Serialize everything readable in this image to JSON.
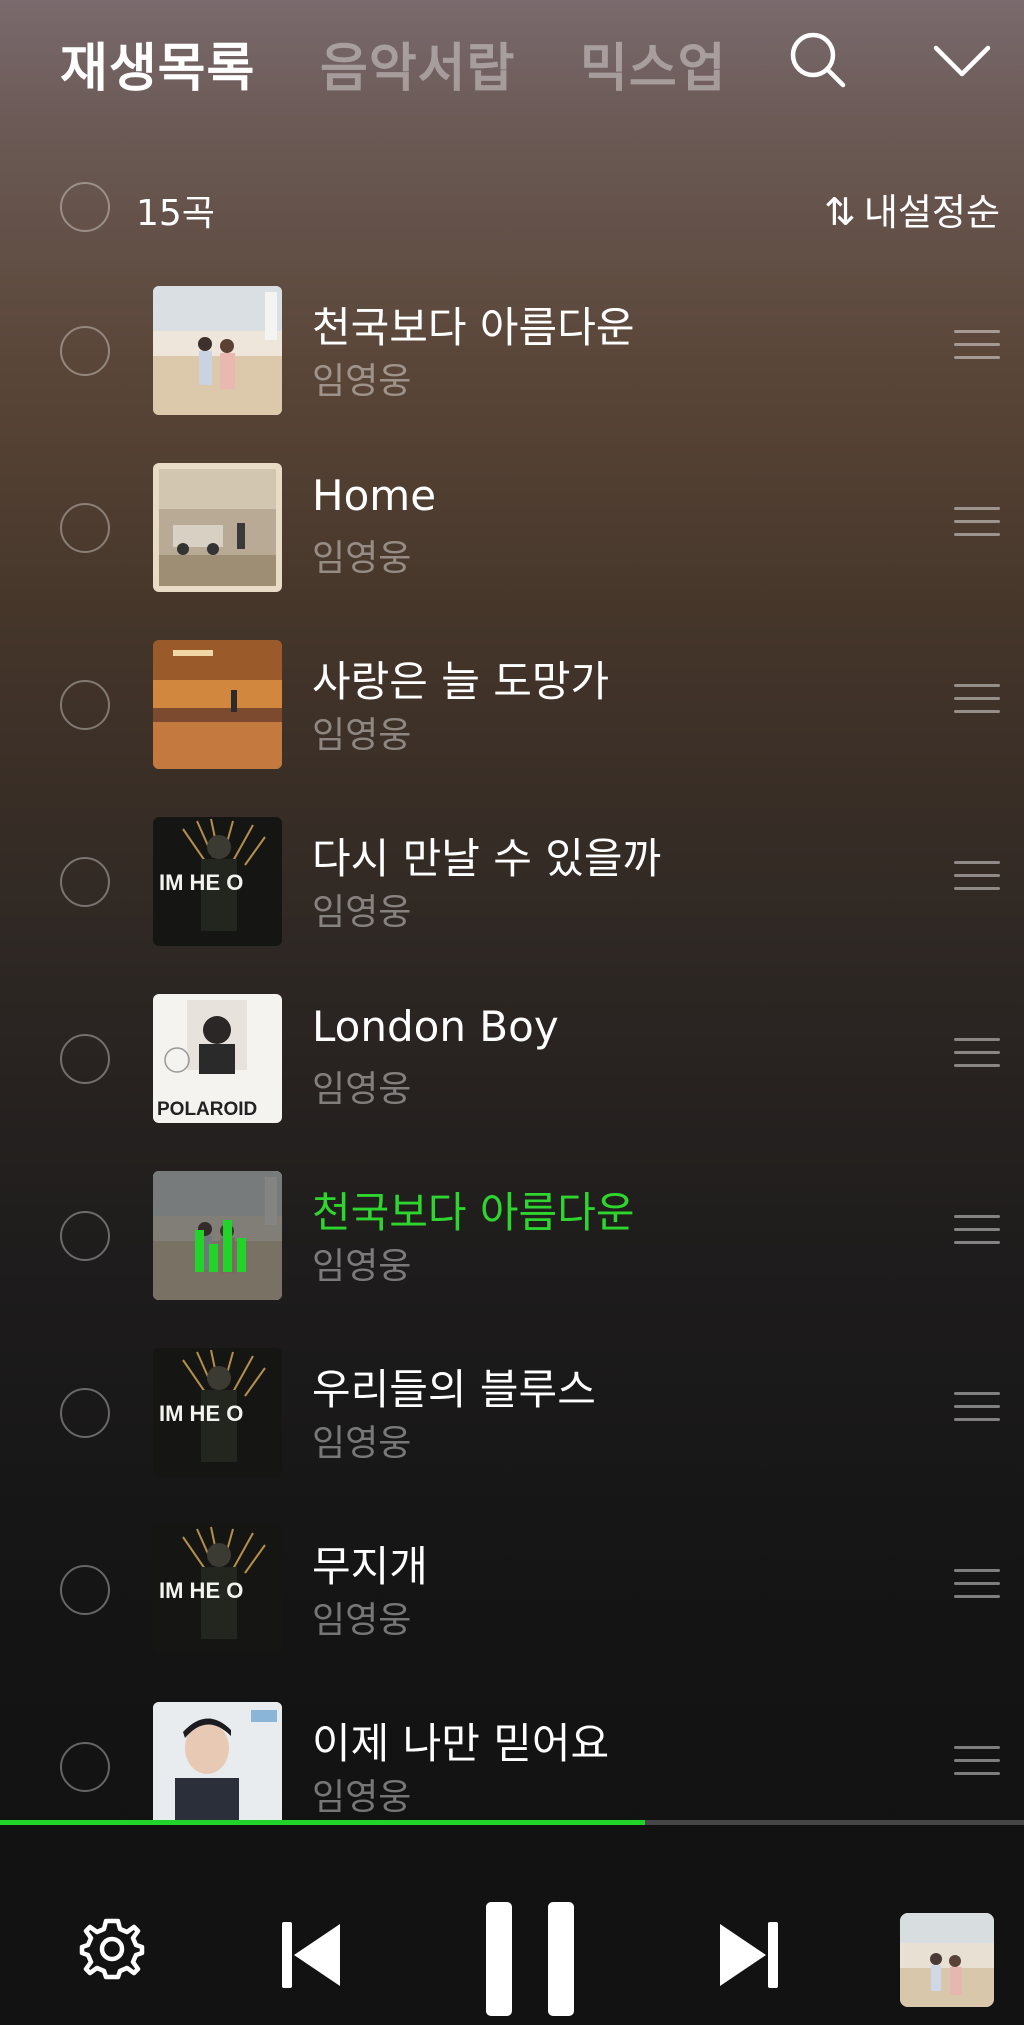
{
  "header": {
    "tabs": [
      {
        "label": "재생목록",
        "active": true
      },
      {
        "label": "음악서랍",
        "active": false
      },
      {
        "label": "믹스업",
        "active": false
      }
    ],
    "icons": [
      "search-icon",
      "chevron-down-icon"
    ]
  },
  "list_header": {
    "count": "15곡",
    "sort_label": "내설정순",
    "sort_icon": "sort-arrows-icon"
  },
  "tracks": [
    {
      "title": "천국보다 아름다운",
      "artist": "임영웅",
      "playing": false,
      "cover": "beach"
    },
    {
      "title": "Home",
      "artist": "임영웅",
      "playing": false,
      "cover": "jeep"
    },
    {
      "title": "사랑은 늘 도망가",
      "artist": "임영웅",
      "playing": false,
      "cover": "sunset"
    },
    {
      "title": "다시 만날 수 있을까",
      "artist": "임영웅",
      "playing": false,
      "cover": "imhero"
    },
    {
      "title": "London Boy",
      "artist": "임영웅",
      "playing": false,
      "cover": "polaroid"
    },
    {
      "title": "천국보다 아름다운",
      "artist": "임영웅",
      "playing": true,
      "cover": "beach"
    },
    {
      "title": "우리들의 블루스",
      "artist": "임영웅",
      "playing": false,
      "cover": "imhero"
    },
    {
      "title": "무지개",
      "artist": "임영웅",
      "playing": false,
      "cover": "imhero"
    },
    {
      "title": "이제 나만 믿어요",
      "artist": "임영웅",
      "playing": false,
      "cover": "portrait"
    }
  ],
  "cover_text": {
    "imhero": "IM HERO",
    "polaroid": "POLAROID"
  },
  "player": {
    "progress": 0.63,
    "icons": [
      "settings-icon",
      "previous-icon",
      "pause-icon",
      "next-icon",
      "now-playing-cover"
    ]
  },
  "colors": {
    "accent_green": "#22d42a",
    "playing_title": "#2ed52e"
  }
}
